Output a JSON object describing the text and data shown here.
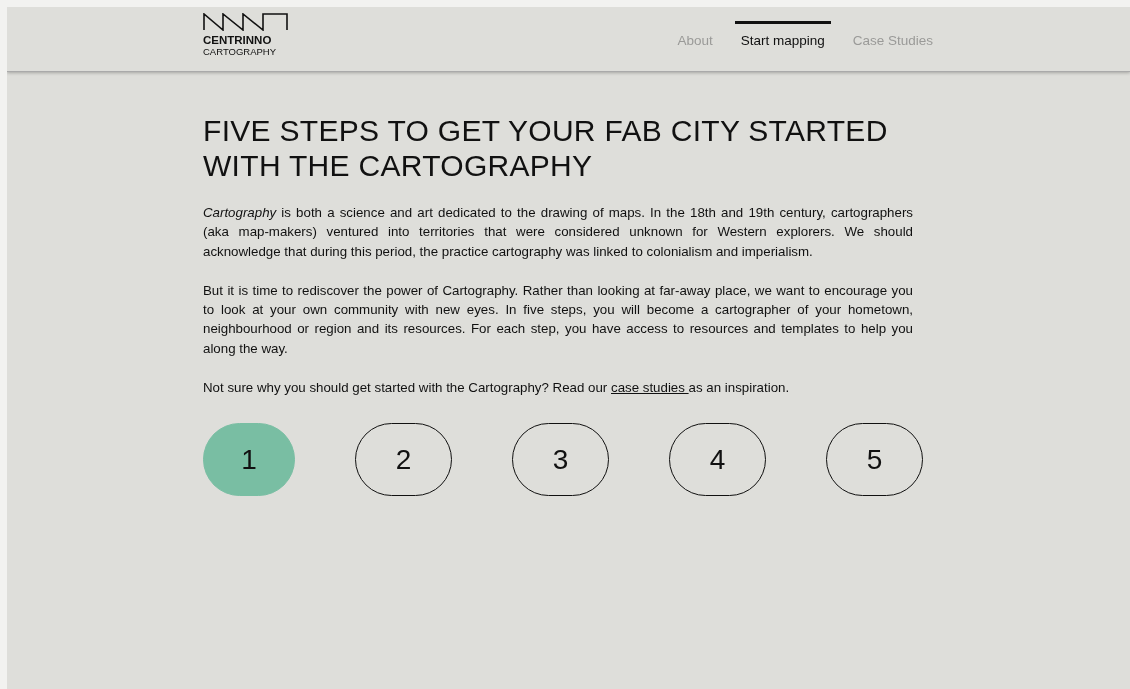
{
  "logo": {
    "title": "CENTRINNO",
    "subtitle": "CARTOGRAPHY"
  },
  "nav": [
    {
      "label": "About",
      "selected": false
    },
    {
      "label": "Start mapping",
      "selected": true
    },
    {
      "label": "Case Studies",
      "selected": false
    }
  ],
  "heading": "FIVE STEPS TO GET YOUR FAB CITY STARTED WITH THE CARTOGRAPHY",
  "paragraphs": [
    "*Cartography* is both a science and art dedicated to the drawing of maps. In the 18th and 19th century, cartographers (aka map-makers) ventured into territories that were considered unknown for Western explorers. We should acknowledge that during this period, the practice cartography was linked to colonialism and imperialism.",
    "But it is time to rediscover the power of Cartography. Rather than looking at  far-away place, we want to encourage you to look at your own community with new eyes. In five steps, you will become a cartographer of your hometown, neighbourhood or region and its resources. For each step, you have access to resources and templates to help you along the way."
  ],
  "note": {
    "before": "Not sure why you should  get started  with the Cartography? Read our ",
    "link": "case studies ",
    "after": "as an inspiration."
  },
  "steps": [
    {
      "label": "1",
      "selected": true
    },
    {
      "label": "2",
      "selected": false
    },
    {
      "label": "3",
      "selected": false
    },
    {
      "label": "4",
      "selected": false
    },
    {
      "label": "5",
      "selected": false
    }
  ]
}
